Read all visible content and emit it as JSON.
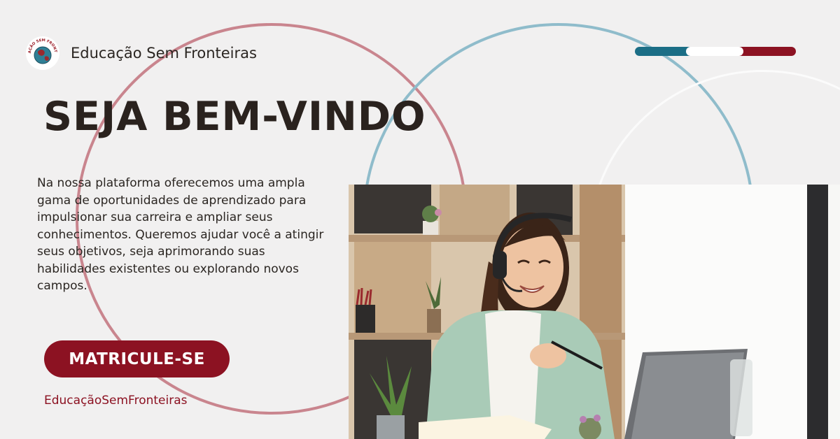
{
  "brand": {
    "name": "Educação Sem Fronteiras",
    "logo_text": "EDUCAÇÃO SEM FRONTEIRAS",
    "logo_icon": "globe-icon"
  },
  "headline": "SEJA BEM-VINDO",
  "intro": "Na nossa plataforma oferecemos uma ampla gama de oportunidades de aprendizado para impulsionar sua carreira e ampliar seus conhecimentos. Queremos ajudar você a atingir seus objetivos, seja aprimorando suas habilidades existentes ou explorando novos campos.",
  "cta_label": "MATRICULE-SE",
  "hashtag": "EducaçãoSemFronteiras",
  "colors": {
    "background": "#f1f0f0",
    "brand_red": "#8c1222",
    "brand_teal": "#1b6e86",
    "circle_rose": "#c9858e",
    "circle_teal": "#8fbccb",
    "text_dark": "#2a221e"
  },
  "photo": {
    "subject": "woman-with-headset-on-laptop"
  }
}
